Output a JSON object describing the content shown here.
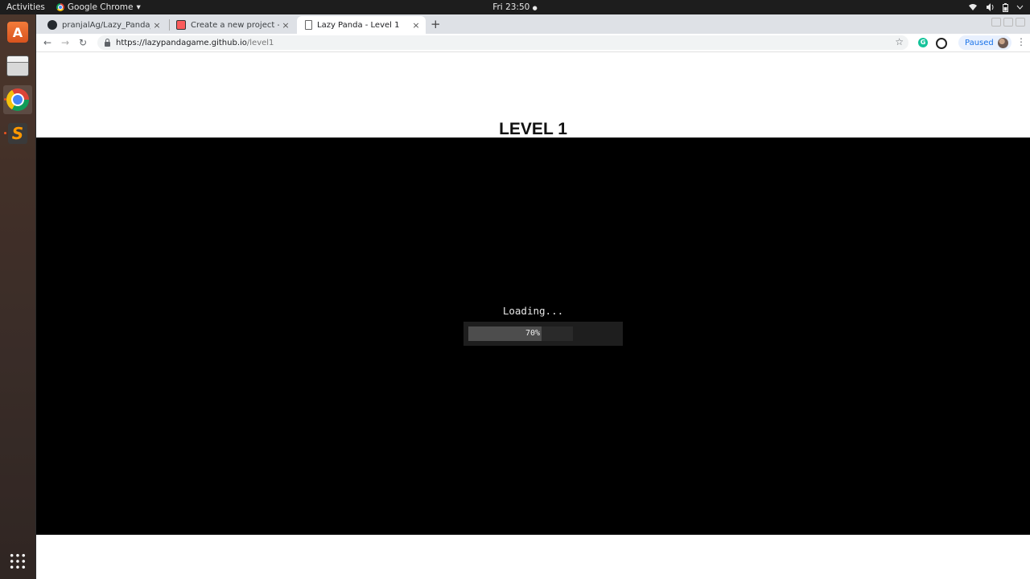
{
  "topbar": {
    "activities": "Activities",
    "app_name": "Google Chrome",
    "app_menu_arrow": "▾",
    "clock": "Fri 23:50",
    "clock_dot": "●",
    "tray_icons": [
      "wifi-icon",
      "volume-icon",
      "battery-icon",
      "power-menu-icon"
    ]
  },
  "dock": {
    "items": [
      "ubuntu-software",
      "files",
      "google-chrome",
      "sublime-text"
    ],
    "show_apps_icon": "grid-icon",
    "software_glyph": "A",
    "sublime_glyph": "S"
  },
  "browser": {
    "tabs": [
      {
        "title": "pranjalAg/Lazy_Panda_g",
        "icon": "github-icon",
        "close": "×"
      },
      {
        "title": "Create a new project - itch",
        "icon": "itch-icon",
        "close": "×"
      },
      {
        "title": "Lazy Panda - Level 1",
        "icon": "page-icon",
        "close": "×"
      }
    ],
    "new_tab": "+",
    "nav": {
      "back": "←",
      "forward": "→",
      "reload": "↻"
    },
    "url_host": "https://lazypandagame.github.io",
    "url_path": "/level1",
    "star": "☆",
    "profile_label": "Paused",
    "menu": "⋮",
    "grammarly_glyph": "G"
  },
  "page": {
    "title": "LEVEL 1",
    "loading_text": "Loading...",
    "progress_text": "70%",
    "progress_fraction": 0.7
  },
  "colors": {
    "canvas_bg": "#000000",
    "progress_panel": "#1e1e1e",
    "progress_fill": "#4d4d4d",
    "accent_blue": "#1a73e8"
  }
}
